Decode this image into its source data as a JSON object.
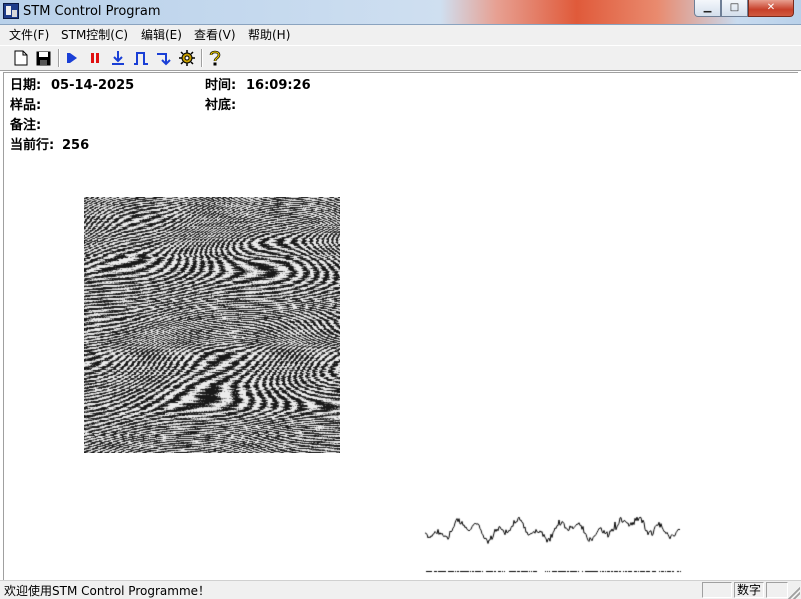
{
  "window": {
    "title": "STM Control Program",
    "min_glyph": "▁",
    "max_glyph": "□",
    "close_glyph": "✕"
  },
  "menu": [
    "文件(F)",
    "STM控制(C)",
    "编辑(E)",
    "查看(V)",
    "帮助(H)"
  ],
  "toolbar": {
    "icons": [
      "new-file-icon",
      "save-icon",
      "start-scan-icon",
      "pause-icon",
      "approach-icon",
      "pulse-icon",
      "step-down-icon",
      "settings-gear-icon",
      "help-icon"
    ],
    "glyphs": {
      "new": "🗋",
      "save": "💾",
      "start": "⏵",
      "pause": "❚❚",
      "approach": "⤓",
      "pulse": "⎍",
      "step": "↴",
      "gear": "⚙",
      "help": "?"
    },
    "colors": {
      "blue": "#1a3fd6",
      "red": "#e01010",
      "black": "#000000",
      "gold": "#c9a000"
    }
  },
  "info": {
    "date_label": "日期:",
    "date_value": "05-14-2025",
    "time_label": "时间:",
    "time_value": "16:09:26",
    "sample_label": "样品:",
    "sample_value": "",
    "substrate_label": "衬底:",
    "substrate_value": "",
    "note_label": "备注:",
    "note_value": "",
    "row_label": "当前行:",
    "row_value": "256"
  },
  "scan": {
    "size_pixels": 256,
    "colormap": "grayscale"
  },
  "profile": {
    "points": 256,
    "line_color": "#000000"
  },
  "status": {
    "message": "欢迎使用STM Control Programme！",
    "pane2": "",
    "pane3": "数字",
    "pane4": ""
  }
}
